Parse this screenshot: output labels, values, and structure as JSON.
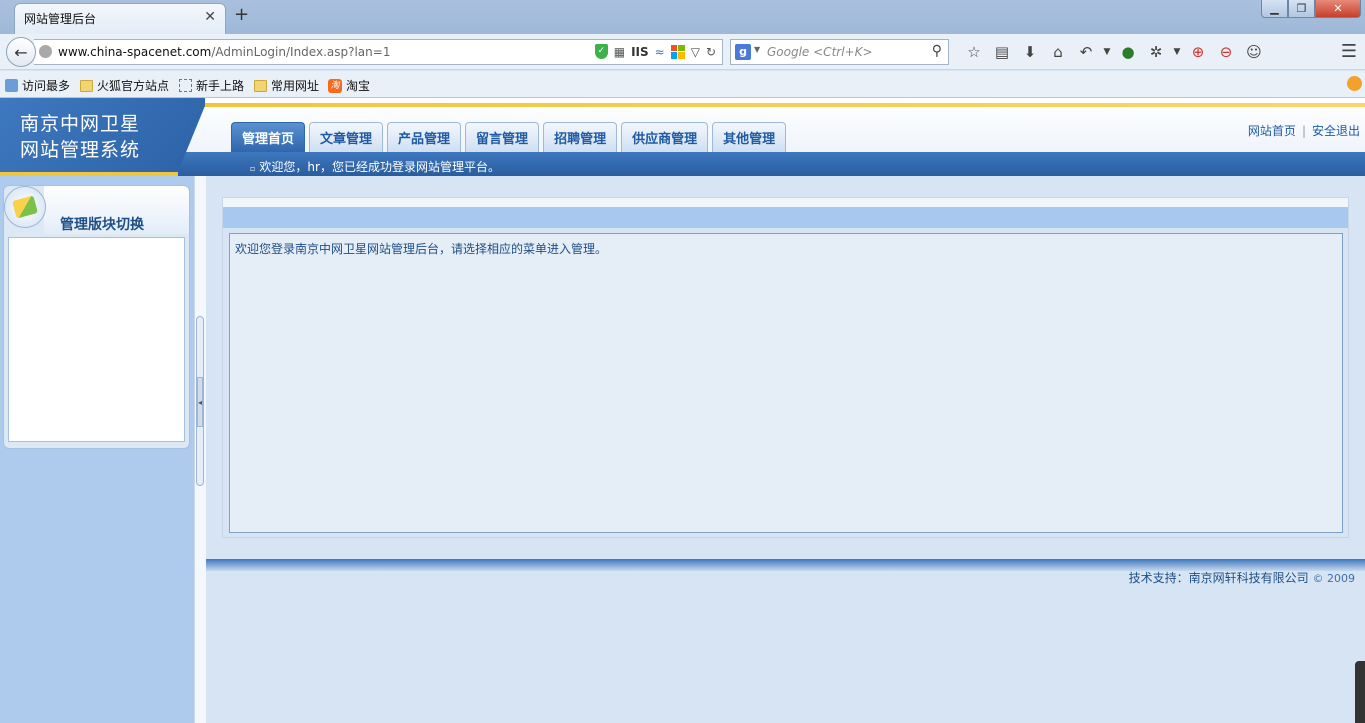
{
  "browser": {
    "tab_title": "网站管理后台",
    "url_host": "www.china-spacenet.com",
    "url_path": "/AdminLogin/Index.asp?lan=1",
    "url_badge": "IIS",
    "search_placeholder": "Google <Ctrl+K>",
    "bookmarks": [
      "访问最多",
      "火狐官方站点",
      "新手上路",
      "常用网址",
      "淘宝"
    ]
  },
  "header": {
    "logo_line1": "南京中网卫星",
    "logo_line2": "网站管理系统",
    "welcome": "欢迎您，hr，您已经成功登录网站管理平台。",
    "tabs": [
      "管理首页",
      "文章管理",
      "产品管理",
      "留言管理",
      "招聘管理",
      "供应商管理",
      "其他管理"
    ],
    "active_tab": "管理首页",
    "link_home": "网站首页",
    "link_sep": "|",
    "link_logout": "安全退出"
  },
  "sidebar": {
    "title": "管理版块切换"
  },
  "main": {
    "message": "欢迎您登录南京中网卫星网站管理后台，请选择相应的菜单进入管理。"
  },
  "footer": {
    "label": "技术支持：",
    "company": "南京网轩科技有限公司",
    "copyright": "© 2009"
  },
  "colors": {
    "brand_blue": "#2f66ad",
    "gold": "#f0c63c",
    "sidebar_bg": "#aecbee"
  }
}
